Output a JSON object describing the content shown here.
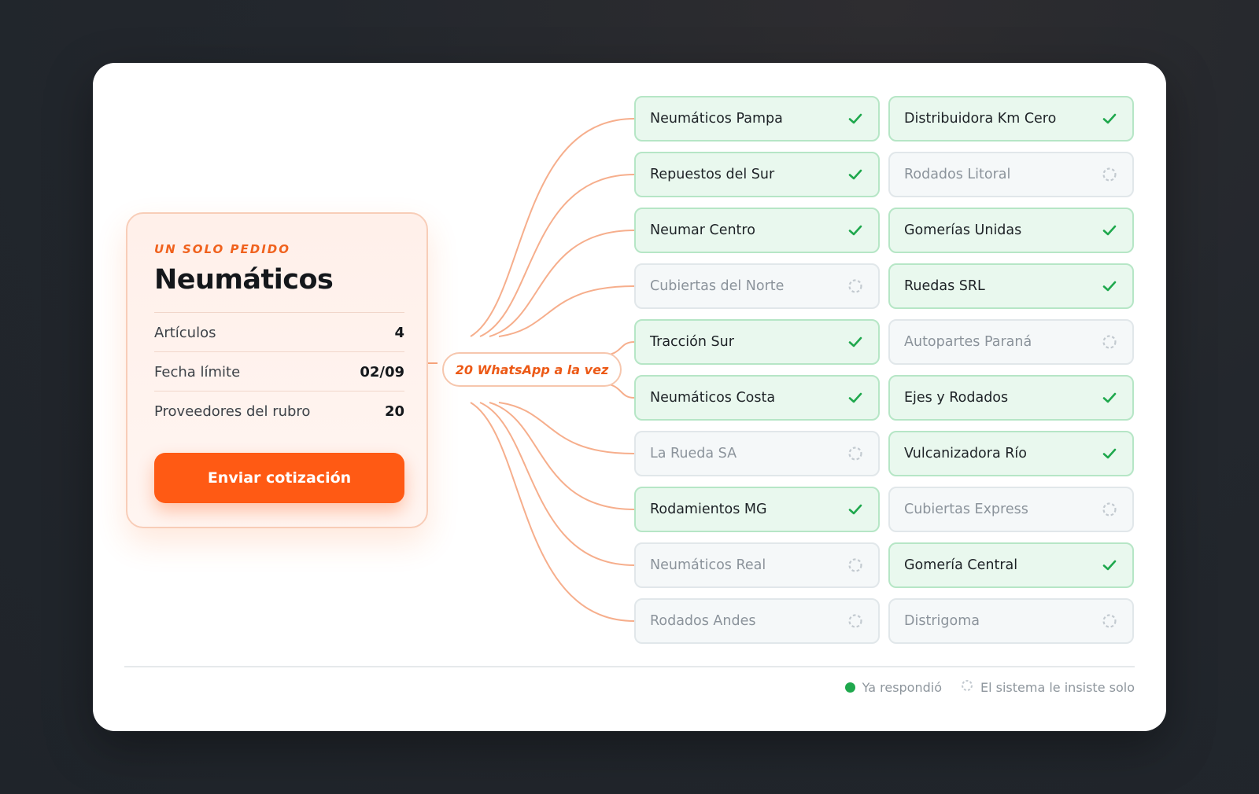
{
  "order": {
    "eyebrow": "UN SOLO PEDIDO",
    "title": "Neumáticos",
    "rows": [
      {
        "label": "Artículos",
        "value": "4"
      },
      {
        "label": "Fecha límite",
        "value": "02/09"
      },
      {
        "label": "Proveedores del rubro",
        "value": "20"
      }
    ],
    "button_label": "Enviar cotización"
  },
  "broadcast": {
    "label": "20 WhatsApp a la vez"
  },
  "suppliers": [
    {
      "name": "Neumáticos Pampa",
      "status": "responded",
      "status_icon": "check-icon"
    },
    {
      "name": "Distribuidora Km Cero",
      "status": "responded",
      "status_icon": "check-icon"
    },
    {
      "name": "Repuestos del Sur",
      "status": "responded",
      "status_icon": "check-icon"
    },
    {
      "name": "Rodados Litoral",
      "status": "pending",
      "status_icon": "spinner-icon"
    },
    {
      "name": "Neumar Centro",
      "status": "responded",
      "status_icon": "check-icon"
    },
    {
      "name": "Gomerías Unidas",
      "status": "responded",
      "status_icon": "check-icon"
    },
    {
      "name": "Cubiertas del Norte",
      "status": "pending",
      "status_icon": "spinner-icon"
    },
    {
      "name": "Ruedas SRL",
      "status": "responded",
      "status_icon": "check-icon"
    },
    {
      "name": "Tracción Sur",
      "status": "responded",
      "status_icon": "check-icon"
    },
    {
      "name": "Autopartes Paraná",
      "status": "pending",
      "status_icon": "spinner-icon"
    },
    {
      "name": "Neumáticos Costa",
      "status": "responded",
      "status_icon": "check-icon"
    },
    {
      "name": "Ejes y Rodados",
      "status": "responded",
      "status_icon": "check-icon"
    },
    {
      "name": "La Rueda SA",
      "status": "pending",
      "status_icon": "spinner-icon"
    },
    {
      "name": "Vulcanizadora Río",
      "status": "responded",
      "status_icon": "check-icon"
    },
    {
      "name": "Rodamientos MG",
      "status": "responded",
      "status_icon": "check-icon"
    },
    {
      "name": "Cubiertas Express",
      "status": "pending",
      "status_icon": "spinner-icon"
    },
    {
      "name": "Neumáticos Real",
      "status": "pending",
      "status_icon": "spinner-icon"
    },
    {
      "name": "Gomería Central",
      "status": "responded",
      "status_icon": "check-icon"
    },
    {
      "name": "Rodados Andes",
      "status": "pending",
      "status_icon": "spinner-icon"
    },
    {
      "name": "Distrigoma",
      "status": "pending",
      "status_icon": "spinner-icon"
    }
  ],
  "legend": {
    "responded_label": "Ya respondió",
    "pending_label": "El sistema le insiste solo"
  },
  "colors": {
    "accent": "#ff5a14",
    "success": "#1fa84d",
    "pending": "#c3cad0",
    "connector": "#f5a57f"
  }
}
